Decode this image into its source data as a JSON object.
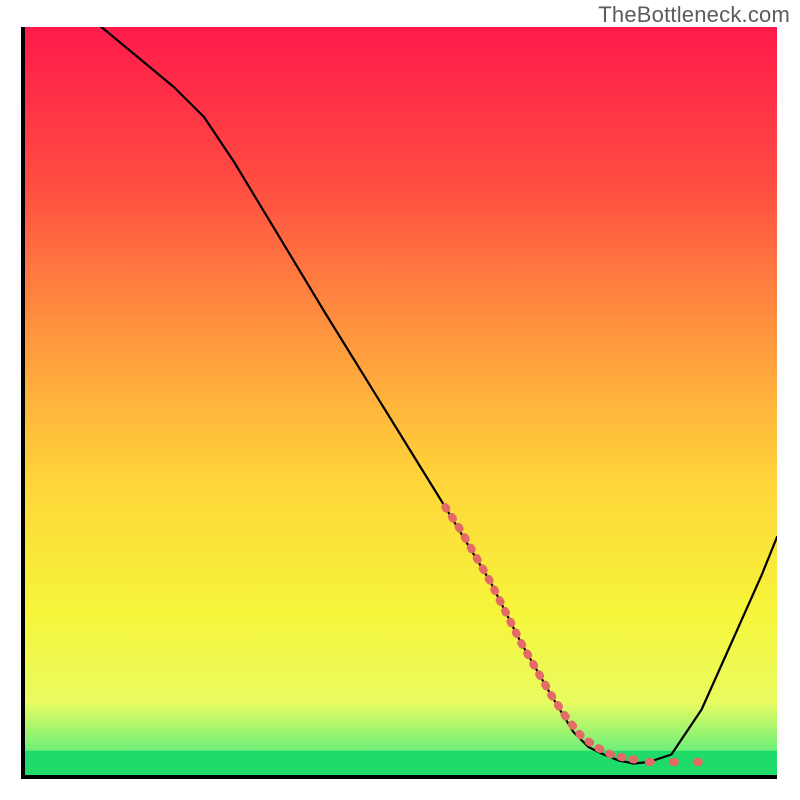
{
  "watermark": {
    "text": "TheBottleneck.com"
  },
  "chart_data": {
    "type": "line",
    "title": "",
    "xlabel": "",
    "ylabel": "",
    "xlim": [
      0,
      100
    ],
    "ylim": [
      0,
      100
    ],
    "grid": false,
    "legend": false,
    "gradient_stops": [
      {
        "offset": 0.0,
        "color": "#ff1a4b"
      },
      {
        "offset": 0.2,
        "color": "#ff4a42"
      },
      {
        "offset": 0.4,
        "color": "#ff923e"
      },
      {
        "offset": 0.6,
        "color": "#ffd43a"
      },
      {
        "offset": 0.78,
        "color": "#f6f53a"
      },
      {
        "offset": 0.9,
        "color": "#e9fb60"
      },
      {
        "offset": 0.965,
        "color": "#6df07a"
      },
      {
        "offset": 1.0,
        "color": "#1fdc6a"
      }
    ],
    "green_band": {
      "y_start": 96.5,
      "y_end": 100
    },
    "axis_stroke": "#000000",
    "curve_stroke": "#000000",
    "dotted_color": "#e36a66",
    "x": [
      0,
      4,
      8,
      14,
      20,
      24,
      28,
      34,
      40,
      48,
      56,
      62,
      66,
      70,
      73,
      75,
      77,
      79,
      81,
      83,
      86,
      90,
      94,
      98,
      100
    ],
    "values": [
      108,
      105,
      102,
      97,
      92,
      88,
      82,
      72,
      62,
      49,
      36,
      26,
      18,
      11,
      6,
      4,
      3,
      2.2,
      1.8,
      2,
      3,
      9,
      18,
      27,
      32
    ],
    "dotted_segment": {
      "x": [
        56,
        58,
        60,
        62,
        64,
        66,
        68,
        70,
        72,
        74,
        76,
        78,
        80,
        82
      ],
      "values": [
        36,
        33,
        29.5,
        26,
        22,
        18,
        14.5,
        11,
        8,
        5.5,
        4,
        3,
        2.5,
        2.2
      ]
    },
    "dotted_tail": {
      "x": [
        83,
        85,
        87,
        89,
        91
      ],
      "values": [
        2,
        2,
        2,
        2,
        2
      ]
    }
  }
}
